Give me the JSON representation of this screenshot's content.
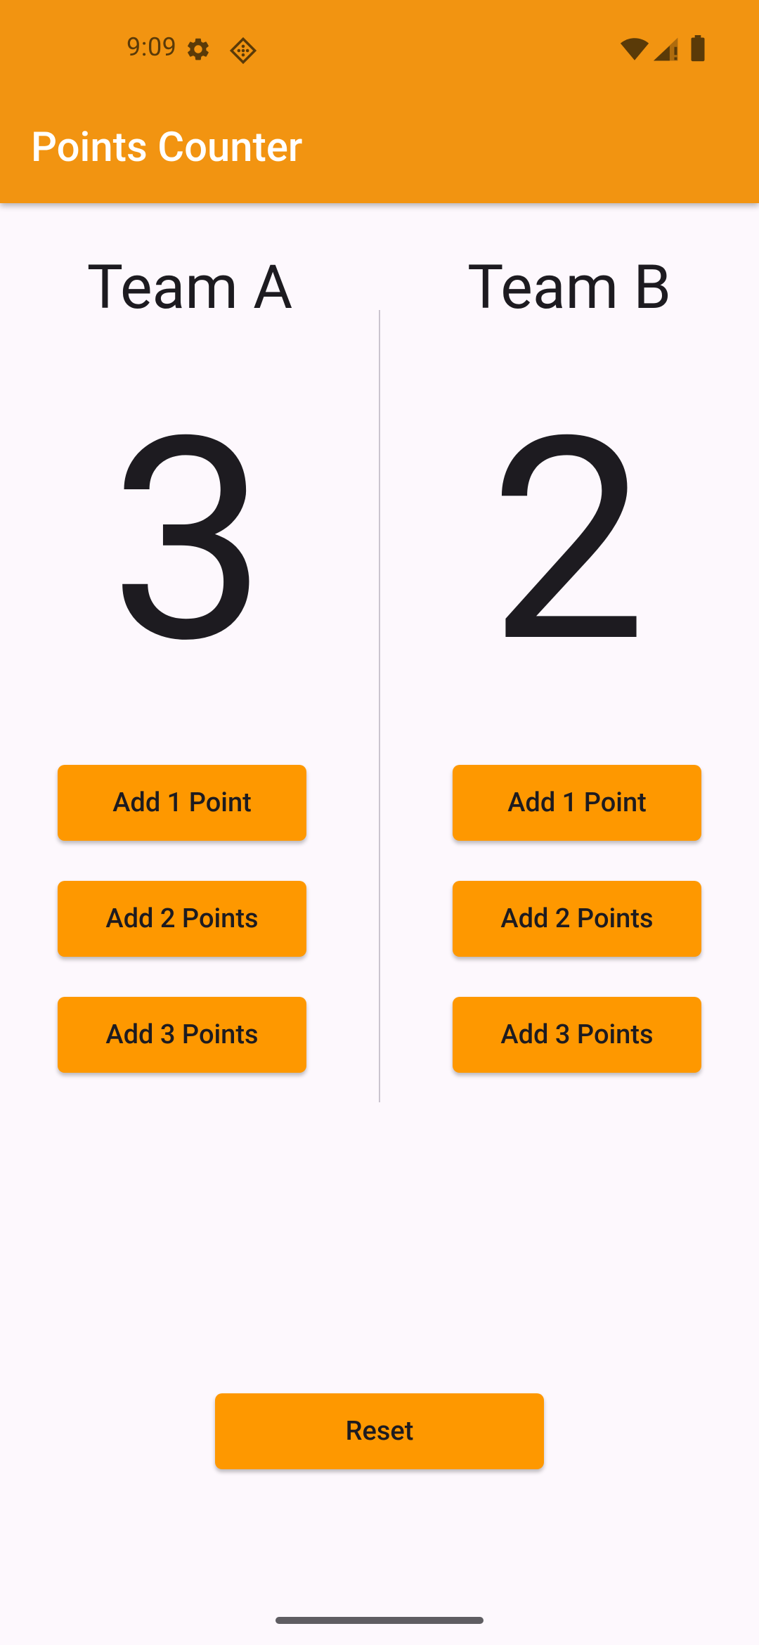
{
  "status_bar": {
    "time": "9:09",
    "icons_left": [
      "gear-icon",
      "diamond-app-icon"
    ],
    "icons_right": [
      "wifi-icon",
      "signal-icon",
      "battery-icon"
    ]
  },
  "app_bar": {
    "title": "Points Counter",
    "color": "#f29411"
  },
  "team_a": {
    "name": "Team A",
    "score": "3",
    "buttons": [
      "Add 1 Point",
      "Add 2 Points",
      "Add 3 Points"
    ]
  },
  "team_b": {
    "name": "Team B",
    "score": "2",
    "buttons": [
      "Add 1 Point",
      "Add 2 Points",
      "Add 3 Points"
    ]
  },
  "reset": {
    "label": "Reset"
  },
  "colors": {
    "button": "#fe9800",
    "background": "#fdf8fd",
    "text": "#1d1b20"
  }
}
